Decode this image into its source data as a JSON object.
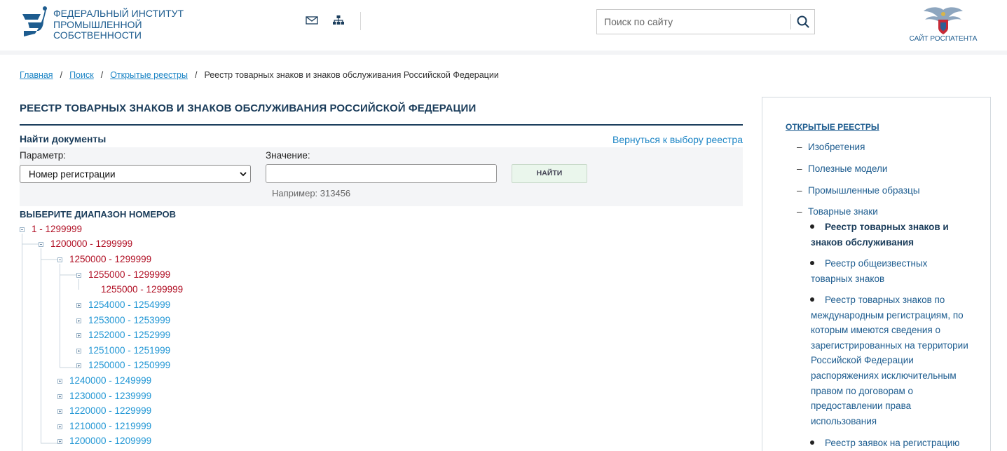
{
  "header": {
    "org_name": [
      "ФЕДЕРАЛЬНЫЙ ИНСТИТУТ",
      "ПРОМЫШЛЕННОЙ",
      "СОБСТВЕННОСТИ"
    ],
    "search_placeholder": "Поиск по сайту",
    "rospatent_label": "САЙТ РОСПАТЕНТА",
    "icons": [
      "mail-icon",
      "sitemap-icon",
      "search-icon"
    ]
  },
  "breadcrumb": {
    "items": [
      "Главная",
      "Поиск",
      "Открытые реестры"
    ],
    "current": "Реестр товарных знаков и знаков обслуживания Российской Федерации"
  },
  "main": {
    "title": "РЕЕСТР ТОВАРНЫХ ЗНАКОВ И ЗНАКОВ ОБСЛУЖИВАНИЯ РОССИЙСКОЙ ФЕДЕРАЦИИ",
    "find_title": "Найти документы",
    "back_link": "Вернуться к выбору реестра",
    "param_label": "Параметр:",
    "param_value": "Номер регистрации",
    "value_label": "Значение:",
    "value_input": "",
    "find_button": "НАЙТИ",
    "example": "Например: 313456",
    "range_title": "ВЫБЕРИТЕ ДИАПАЗОН НОМЕРОВ"
  },
  "tree": [
    {
      "label": "1 - 1299999",
      "state": "open"
    },
    {
      "label": "1200000 - 1299999",
      "state": "open"
    },
    {
      "label": "1250000 - 1299999",
      "state": "open"
    },
    {
      "label": "1255000 - 1299999",
      "state": "open"
    },
    {
      "label": "1255000 - 1299999",
      "state": "leaf"
    },
    {
      "label": "1254000 - 1254999",
      "state": "closed"
    },
    {
      "label": "1253000 - 1253999",
      "state": "closed"
    },
    {
      "label": "1252000 - 1252999",
      "state": "closed"
    },
    {
      "label": "1251000 - 1251999",
      "state": "closed"
    },
    {
      "label": "1250000 - 1250999",
      "state": "closed"
    },
    {
      "label": "1240000 - 1249999",
      "state": "closed"
    },
    {
      "label": "1230000 - 1239999",
      "state": "closed"
    },
    {
      "label": "1220000 - 1229999",
      "state": "closed"
    },
    {
      "label": "1210000 - 1219999",
      "state": "closed"
    },
    {
      "label": "1200000 - 1209999",
      "state": "closed"
    }
  ],
  "sidebar": {
    "title": "ОТКРЫТЫЕ РЕЕСТРЫ",
    "items": [
      "Изобретения",
      "Полезные модели",
      "Промышленные образцы",
      "Товарные знаки"
    ],
    "sub_items": [
      "Реестр товарных знаков и знаков обслуживания",
      "Реестр общеизвестных товарных знаков",
      "Реестр товарных знаков по международным регистрациям, по которым имеются сведения о зарегистрированных на территории Российской Федерации распоряжениях исключительным правом по договорам о предоставлении права использования",
      "Реестр заявок на регистрацию"
    ]
  }
}
